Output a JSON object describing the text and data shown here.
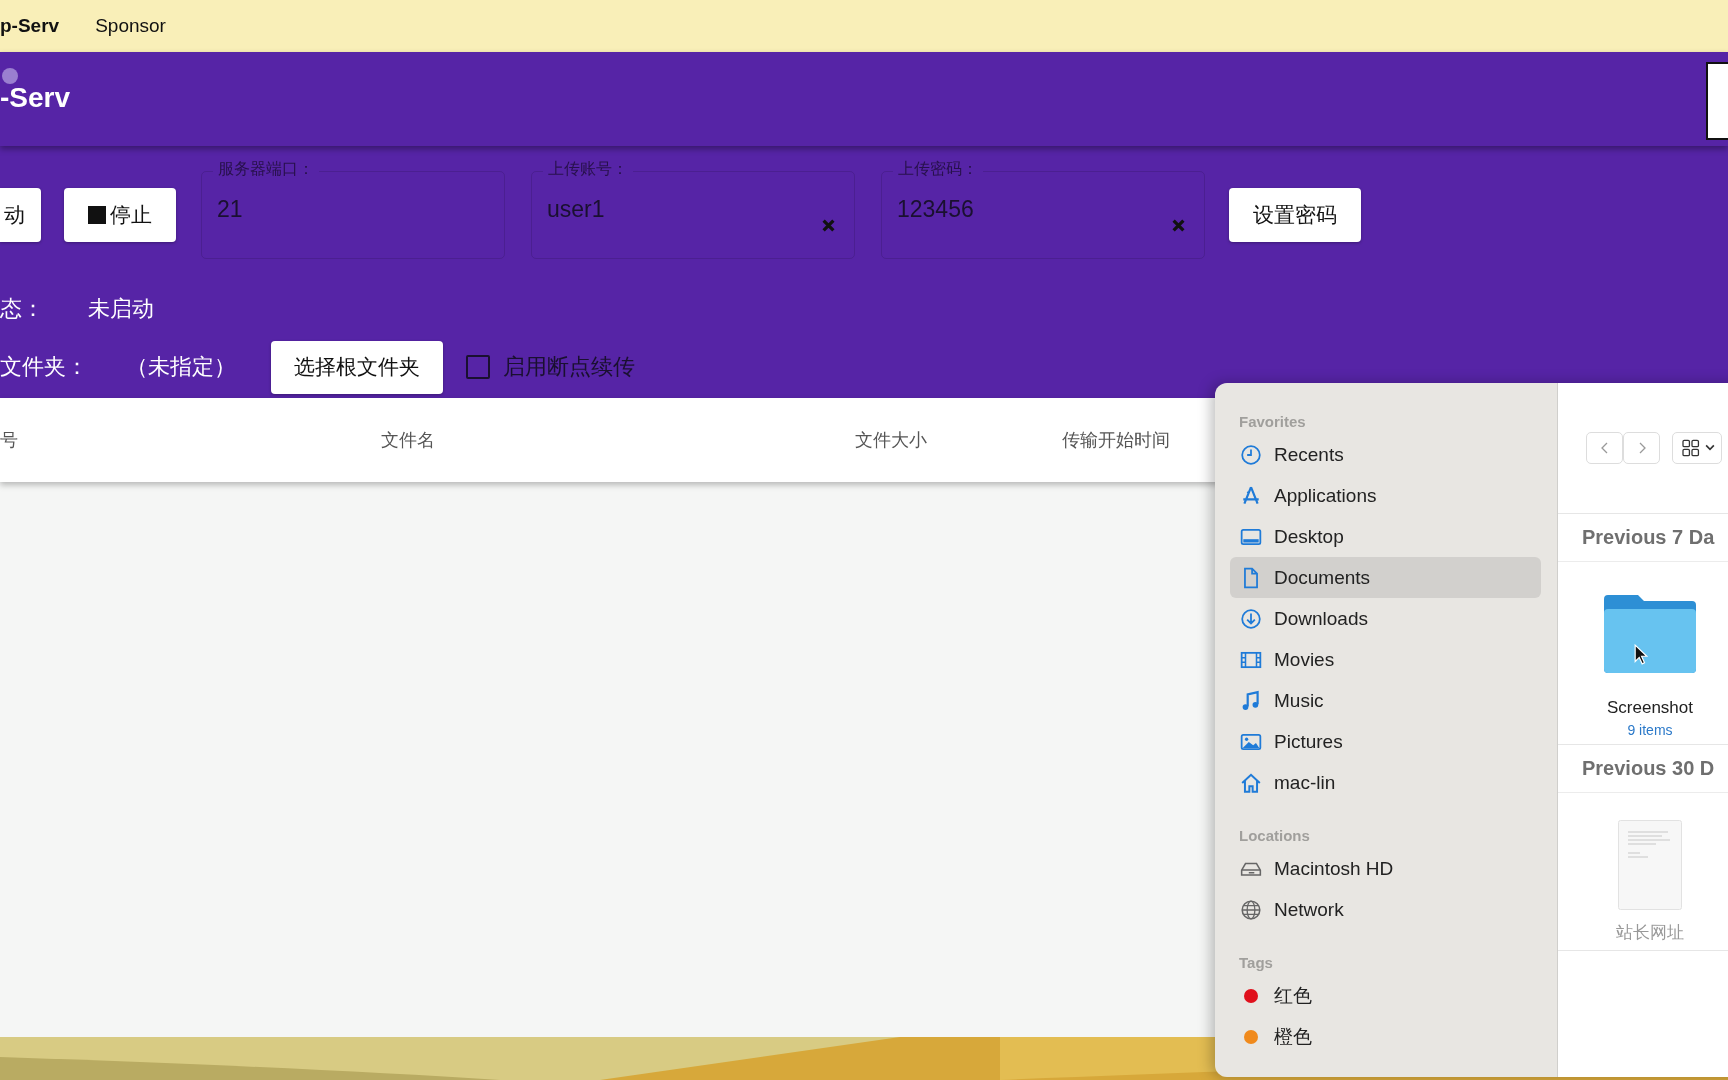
{
  "menu_bar": {
    "app_name": "p-Serv",
    "items": [
      "Sponsor"
    ]
  },
  "header": {
    "title": "-Serv"
  },
  "controls": {
    "buttons": [
      {
        "label": "动",
        "kind": "start"
      },
      {
        "label": "停止",
        "kind": "stop"
      }
    ],
    "fields": [
      {
        "label": "服务器端口：",
        "value": "21",
        "clearable": false
      },
      {
        "label": "上传账号：",
        "value": "user1",
        "clearable": true
      },
      {
        "label": "上传密码：",
        "value": "123456",
        "clearable": true
      }
    ],
    "set_password_button": "设置密码"
  },
  "status": {
    "label": "态：",
    "value": "未启动"
  },
  "root_folder": {
    "label": "文件夹：",
    "value": "（未指定）",
    "button": "选择根文件夹"
  },
  "resume_option": {
    "label": "启用断点续传",
    "checked": false
  },
  "table": {
    "columns": [
      "号",
      "文件名",
      "文件大小",
      "传输开始时间"
    ]
  },
  "file_dialog": {
    "sidebar": [
      {
        "heading": "Favorites",
        "items": [
          {
            "label": "Recents",
            "kind": "recents",
            "selected": false
          },
          {
            "label": "Applications",
            "kind": "applications",
            "selected": false
          },
          {
            "label": "Desktop",
            "kind": "desktop",
            "selected": false
          },
          {
            "label": "Documents",
            "kind": "documents",
            "selected": true
          },
          {
            "label": "Downloads",
            "kind": "downloads",
            "selected": false
          },
          {
            "label": "Movies",
            "kind": "movies",
            "selected": false
          },
          {
            "label": "Music",
            "kind": "music",
            "selected": false
          },
          {
            "label": "Pictures",
            "kind": "pictures",
            "selected": false
          },
          {
            "label": "mac-lin",
            "kind": "home",
            "selected": false
          }
        ]
      },
      {
        "heading": "Locations",
        "items": [
          {
            "label": "Macintosh HD",
            "kind": "disk",
            "selected": false
          },
          {
            "label": "Network",
            "kind": "network",
            "selected": false
          }
        ]
      },
      {
        "heading": "Tags",
        "items": [
          {
            "label": "红色",
            "kind": "tag",
            "color": "#e0101c",
            "selected": false
          },
          {
            "label": "橙色",
            "kind": "tag",
            "color": "#f08a1c",
            "selected": false
          }
        ]
      }
    ],
    "sections": [
      {
        "heading": "Previous 7 Da",
        "items": [
          {
            "name": "Screenshot",
            "detail": "9 items",
            "kind": "folder"
          }
        ]
      },
      {
        "heading": "Previous 30 D",
        "items": [
          {
            "name": "站长网址",
            "kind": "document"
          }
        ]
      }
    ]
  }
}
